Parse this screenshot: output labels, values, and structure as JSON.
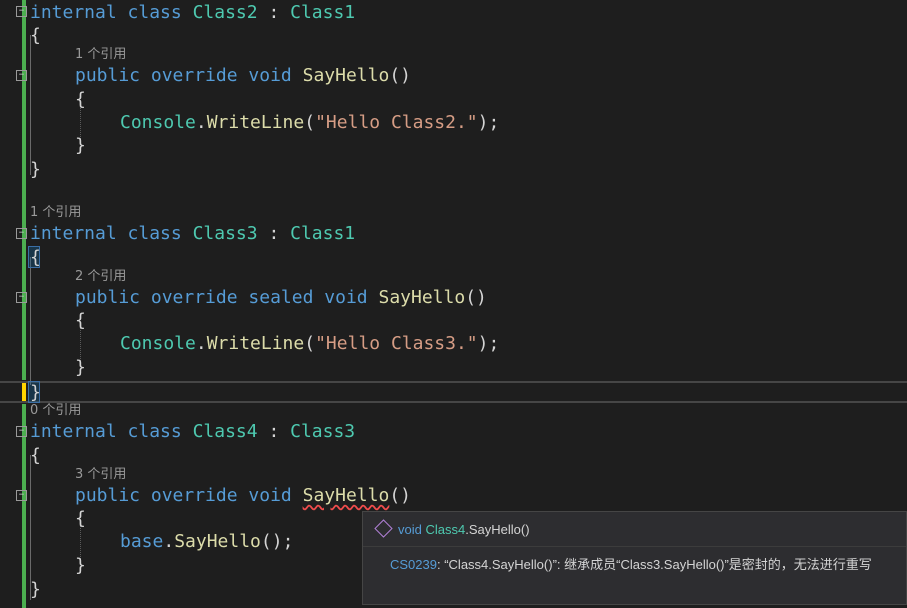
{
  "code": {
    "class2": {
      "decl": {
        "internal": "internal",
        "class": "class",
        "name": "Class2",
        "colon": " : ",
        "base": "Class1"
      },
      "method_lens": "1 个引用",
      "method": {
        "public": "public",
        "override": "override",
        "void": "void",
        "name": "SayHello",
        "parens": "()"
      },
      "body": {
        "obj": "Console",
        "dot": ".",
        "call": "WriteLine",
        "open": "(",
        "str": "\"Hello Class2.\"",
        "close": ");"
      }
    },
    "class3": {
      "lens": "1 个引用",
      "decl": {
        "internal": "internal",
        "class": "class",
        "name": "Class3",
        "colon": " : ",
        "base": "Class1"
      },
      "method_lens": "2 个引用",
      "method": {
        "public": "public",
        "override": "override",
        "sealed": "sealed",
        "void": "void",
        "name": "SayHello",
        "parens": "()"
      },
      "body": {
        "obj": "Console",
        "dot": ".",
        "call": "WriteLine",
        "open": "(",
        "str": "\"Hello Class3.\"",
        "close": ");"
      }
    },
    "class4": {
      "lens": "0 个引用",
      "decl": {
        "internal": "internal",
        "class": "class",
        "name": "Class4",
        "colon": " : ",
        "base": "Class3"
      },
      "method_lens": "3 个引用",
      "method": {
        "public": "public",
        "override": "override",
        "void": "void",
        "name": "SayHello",
        "parens": "()"
      },
      "body": {
        "obj": "base",
        "dot": ".",
        "call": "SayHello",
        "rest": "();"
      }
    },
    "open_brace": "{",
    "close_brace": "}"
  },
  "tooltip": {
    "sig_void": "void",
    "sig_class": "Class4",
    "sig_rest": ".SayHello()",
    "error_code": "CS0239",
    "error_message": ": “Class4.SayHello()”: 继承成员“Class3.SayHello()”是密封的，无法进行重写"
  },
  "colors": {
    "keyword": "#569cd6",
    "type": "#4ec9b0",
    "method": "#dcdcaa",
    "string": "#d69d85",
    "error": "#f14c4c"
  }
}
